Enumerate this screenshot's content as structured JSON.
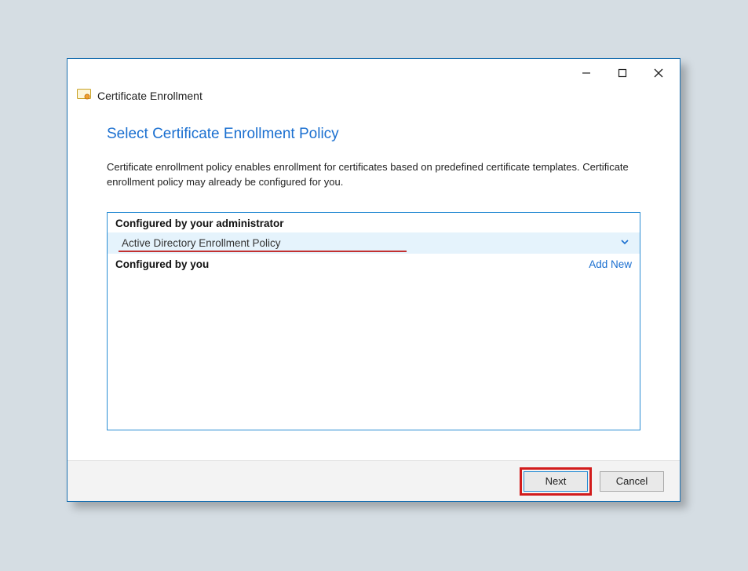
{
  "window": {
    "title": "Certificate Enrollment"
  },
  "page": {
    "heading": "Select Certificate Enrollment Policy",
    "description": "Certificate enrollment policy enables enrollment for certificates based on predefined certificate templates. Certificate enrollment policy may already be configured for you."
  },
  "sections": {
    "admin_header": "Configured by your administrator",
    "admin_policy": "Active Directory Enrollment Policy",
    "user_header": "Configured by you",
    "add_new_label": "Add New"
  },
  "buttons": {
    "next": "Next",
    "cancel": "Cancel"
  }
}
